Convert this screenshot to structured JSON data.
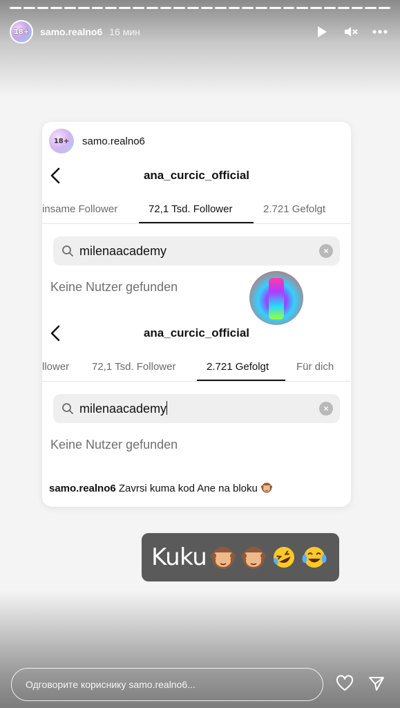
{
  "story": {
    "progress_segments": 28,
    "username": "samo.realno6",
    "time_ago": "16 мин",
    "avatar_text": "18+"
  },
  "post": {
    "author": "samo.realno6",
    "avatar_text": "18+",
    "screens": [
      {
        "title": "ana_curcic_official",
        "tabs": [
          "insame Follower",
          "72,1 Tsd. Follower",
          "2.721 Gefolgt"
        ],
        "active_tab": 1,
        "search_value": "milenaacademy",
        "empty_message": "Keine Nutzer gefunden"
      },
      {
        "title": "ana_curcic_official",
        "tabs": [
          "llower",
          "72,1 Tsd. Follower",
          "2.721 Gefolgt",
          "Für dich"
        ],
        "active_tab": 2,
        "search_value": "milenaacademy",
        "empty_message": "Keine Nutzer gefunden"
      }
    ],
    "caption_user": "samo.realno6",
    "caption_text": "Zavrsi kuma kod Ane na bloku"
  },
  "sticker": {
    "text": "Kuku",
    "emojis": [
      "see-no-evil-monkey",
      "see-no-evil-monkey",
      "rolling-on-floor-laughing",
      "tears-of-joy"
    ]
  },
  "reply": {
    "placeholder": "Одговорите кориснику samo.realno6..."
  },
  "colors": {
    "sticker_bg": "#5a5a5a",
    "search_bg": "#efefef"
  }
}
